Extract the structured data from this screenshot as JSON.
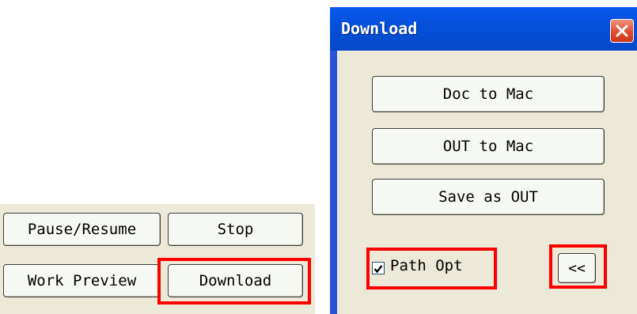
{
  "left_panel": {
    "pause_resume_label": "Pause/Resume",
    "stop_label": "Stop",
    "work_preview_label": "Work Preview",
    "download_label": "Download"
  },
  "dialog": {
    "title": "Download",
    "close_icon": "close-icon",
    "doc_to_mac_label": "Doc to Mac",
    "out_to_mac_label": "OUT to Mac",
    "save_as_out_label": "Save as OUT",
    "path_opt": {
      "label": "Path Opt",
      "checked": true
    },
    "collapse_label": "<<"
  },
  "colors": {
    "highlight": "#ff0000",
    "titlebar": "#0550d8",
    "panel_background": "#ece9d8",
    "close_button": "#e0482a"
  }
}
